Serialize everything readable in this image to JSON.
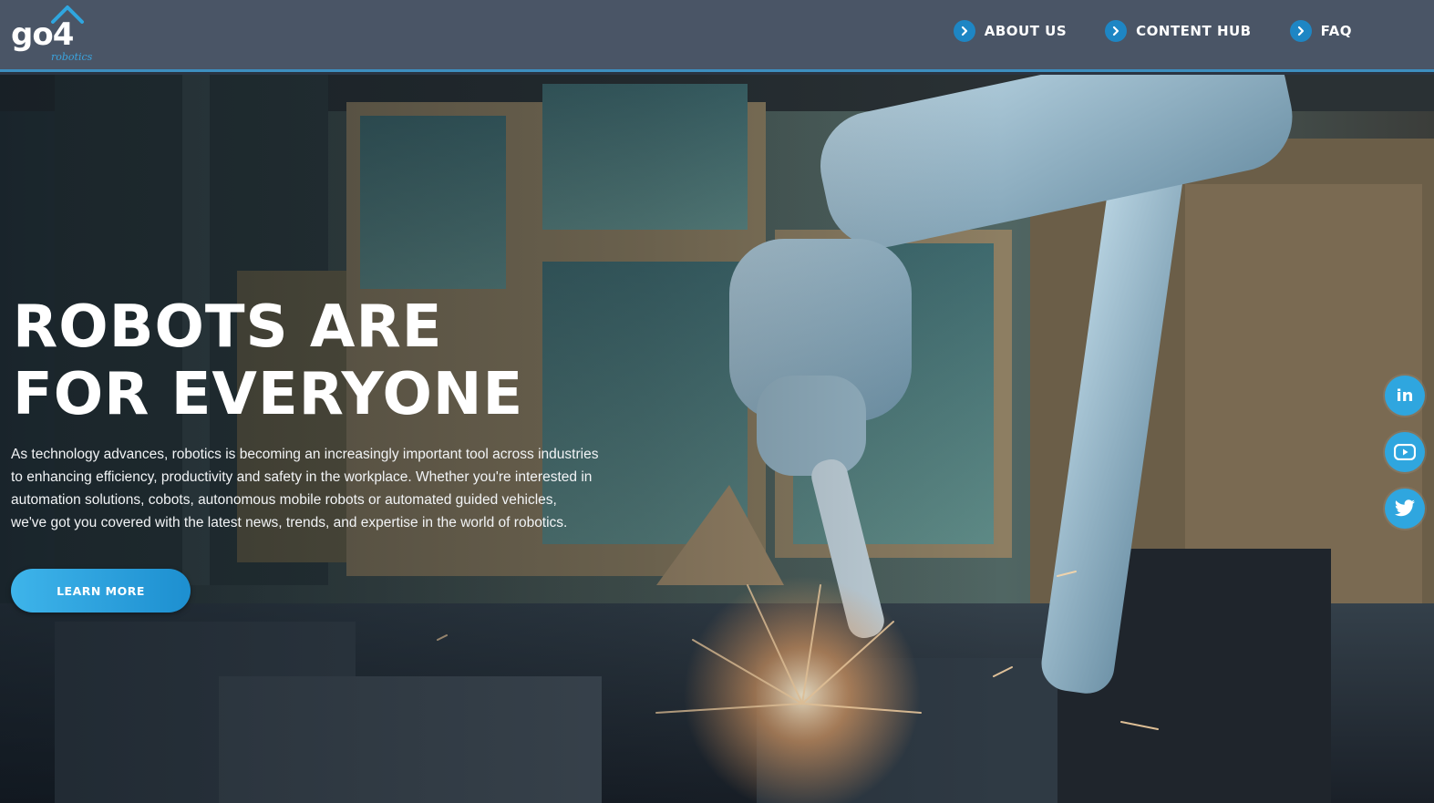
{
  "brand": {
    "logo_text": "go4",
    "logo_sub": "robotics",
    "accent": "#1e86c4",
    "header_bg": "#4a5566"
  },
  "nav": {
    "items": [
      {
        "label": "ABOUT US",
        "icon": "chevron-right-icon"
      },
      {
        "label": "CONTENT HUB",
        "icon": "chevron-right-icon"
      },
      {
        "label": "FAQ",
        "icon": "chevron-right-icon"
      }
    ]
  },
  "hero": {
    "title_line1": "ROBOTS ARE",
    "title_line2": "FOR EVERYONE",
    "body_line1": "As technology advances, robotics is becoming an increasingly important tool across industries",
    "body_line2": "to enhancing efficiency, productivity and safety in the workplace. Whether you're interested in",
    "body_line3": "automation solutions, cobots, autonomous mobile robots or automated guided vehicles,",
    "body_line4": "we've got you covered with the latest news, trends, and expertise in the world of robotics.",
    "cta_label": "LEARN MORE",
    "cta_color": "#2ea6e0"
  },
  "social": {
    "items": [
      {
        "name": "linkedin",
        "icon": "linkedin-icon",
        "glyph": "in"
      },
      {
        "name": "youtube",
        "icon": "youtube-icon"
      },
      {
        "name": "twitter",
        "icon": "twitter-icon"
      }
    ],
    "color": "#2fa6df"
  }
}
